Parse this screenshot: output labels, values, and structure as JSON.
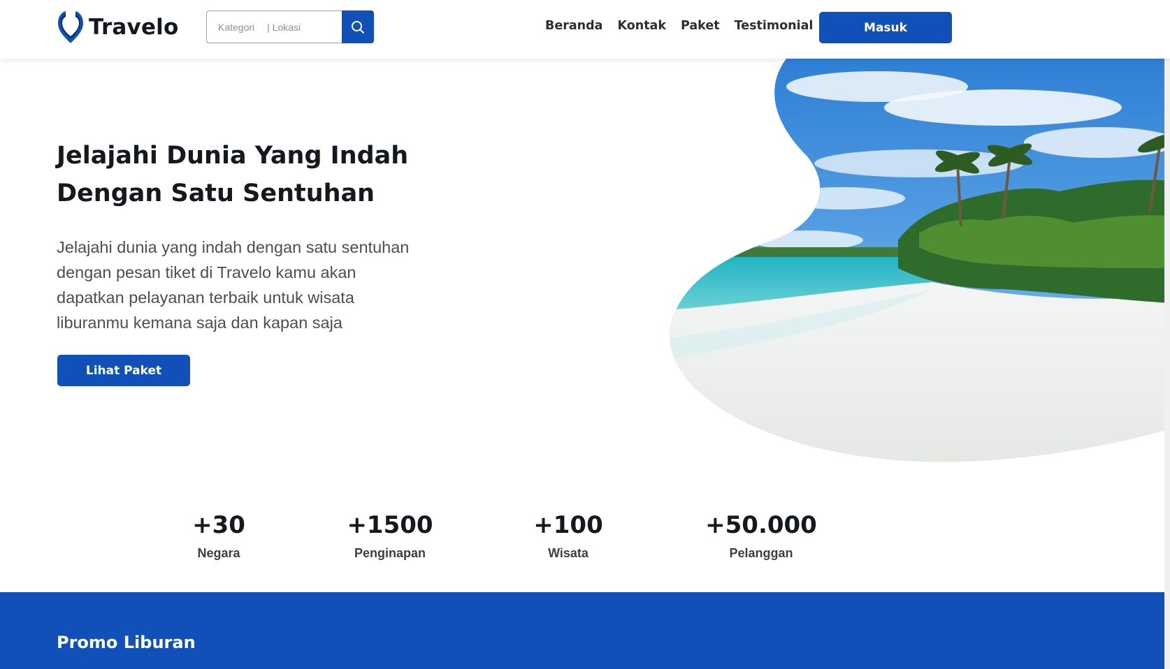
{
  "brand": {
    "name": "Travelo",
    "accent": "#1150b8"
  },
  "search": {
    "category_placeholder": "Kategori",
    "location_placeholder": "| Lokasi",
    "icon": "search-icon"
  },
  "nav": {
    "items": [
      "Beranda",
      "Kontak",
      "Paket",
      "Testimonial"
    ],
    "login_label": "Masuk"
  },
  "hero": {
    "title_line1": "Jelajahi Dunia Yang Indah",
    "title_line2": "Dengan Satu Sentuhan",
    "desc_line1": "Jelajahi dunia yang indah dengan satu sentuhan",
    "desc_line2": "dengan pesan tiket di Travelo kamu akan",
    "desc_line3": "dapatkan pelayanan terbaik untuk wisata",
    "desc_line4": "liburanmu kemana saja dan kapan saja",
    "cta_label": "Lihat Paket",
    "image": "beach-image"
  },
  "stats": [
    {
      "value": "+30",
      "label": "Negara"
    },
    {
      "value": "+1500",
      "label": "Penginapan"
    },
    {
      "value": "+100",
      "label": "Wisata"
    },
    {
      "value": "+50.000",
      "label": "Pelanggan"
    }
  ],
  "promo": {
    "title": "Promo Liburan"
  }
}
